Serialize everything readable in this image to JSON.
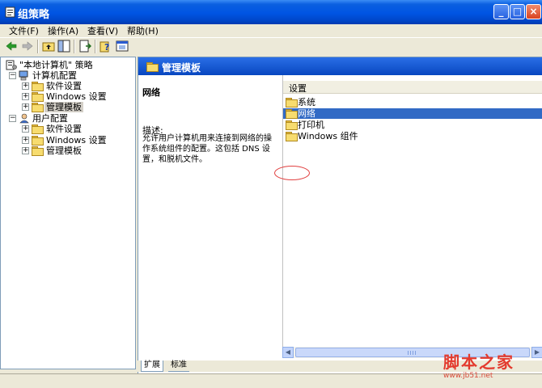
{
  "window": {
    "title": "组策略"
  },
  "title_controls": {
    "minimize": "_",
    "maximize": "□",
    "close": "×"
  },
  "menu": [
    "文件(F)",
    "操作(A)",
    "查看(V)",
    "帮助(H)"
  ],
  "tree": {
    "root": "\"本地计算机\" 策略",
    "computer_config": "计算机配置",
    "computer_children": [
      "软件设置",
      "Windows 设置",
      "管理模板"
    ],
    "user_config": "用户配置",
    "user_children": [
      "软件设置",
      "Windows 设置",
      "管理模板"
    ]
  },
  "panel": {
    "header": "管理模板",
    "selected_name": "网络",
    "desc_heading": "描述:",
    "desc_text": "允许用户计算机用来连接到网络的操作系统组件的配置。这包括 DNS 设置，和脱机文件。"
  },
  "list": {
    "column": "设置",
    "items": [
      "系统",
      "网络",
      "打印机",
      "Windows 组件"
    ],
    "selected_index": 1
  },
  "tabs": [
    "扩展",
    "标准"
  ],
  "watermark": {
    "text": "脚本之家",
    "url": "www.jb51.net"
  },
  "colors": {
    "titlebar": "#0054e3",
    "selection": "#316ac5",
    "header": "#0a58d6",
    "annotation": "#e14040"
  }
}
